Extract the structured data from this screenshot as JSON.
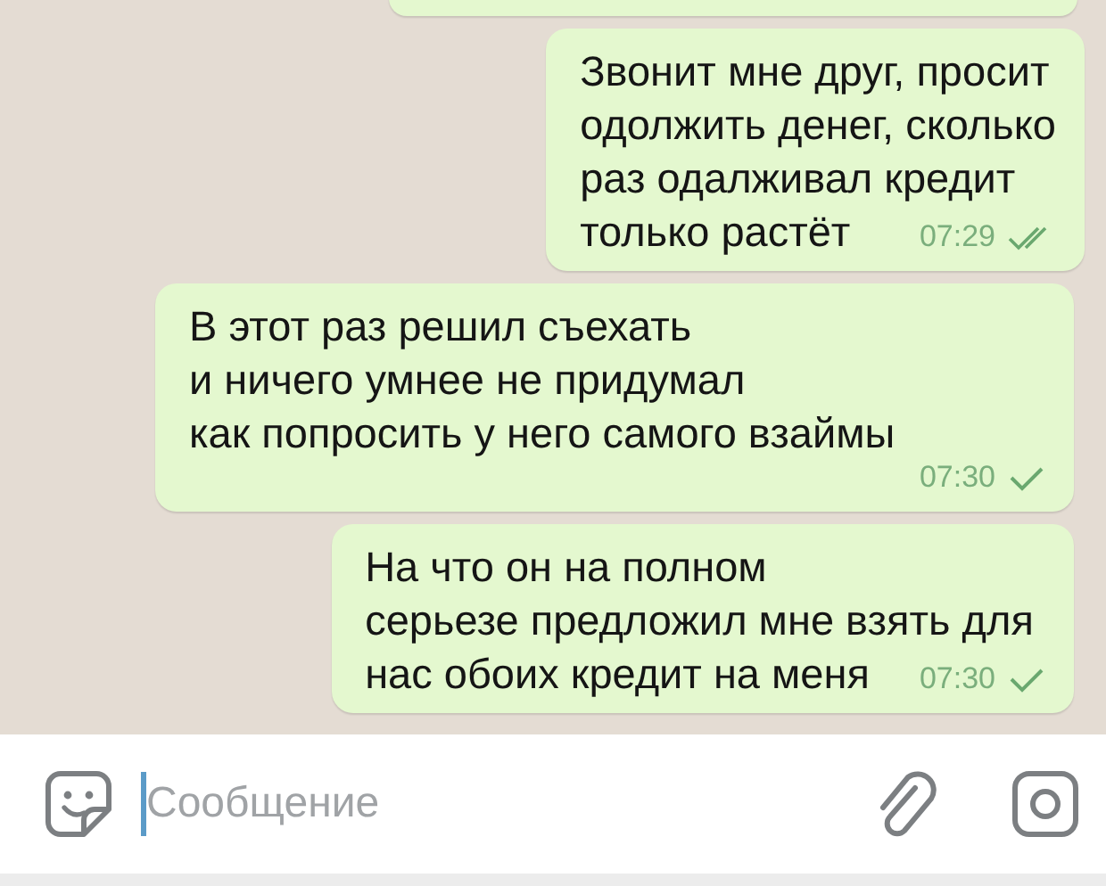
{
  "messages": [
    {
      "lines": [
        "Звонит мне друг, просит",
        "одолжить денег, сколько",
        "раз одалживал кредит",
        "только растёт"
      ],
      "time": "07:29",
      "read": true
    },
    {
      "lines": [
        "В этот раз решил съехать",
        "и ничего умнее не придумал",
        "как попросить у него самого взаймы"
      ],
      "time": "07:30",
      "read": false
    },
    {
      "lines": [
        "На что он на полном",
        "серьезе предложил мне взять для",
        "нас обоих кредит на меня"
      ],
      "time": "07:30",
      "read": false
    }
  ],
  "composer": {
    "placeholder": "Сообщение"
  }
}
